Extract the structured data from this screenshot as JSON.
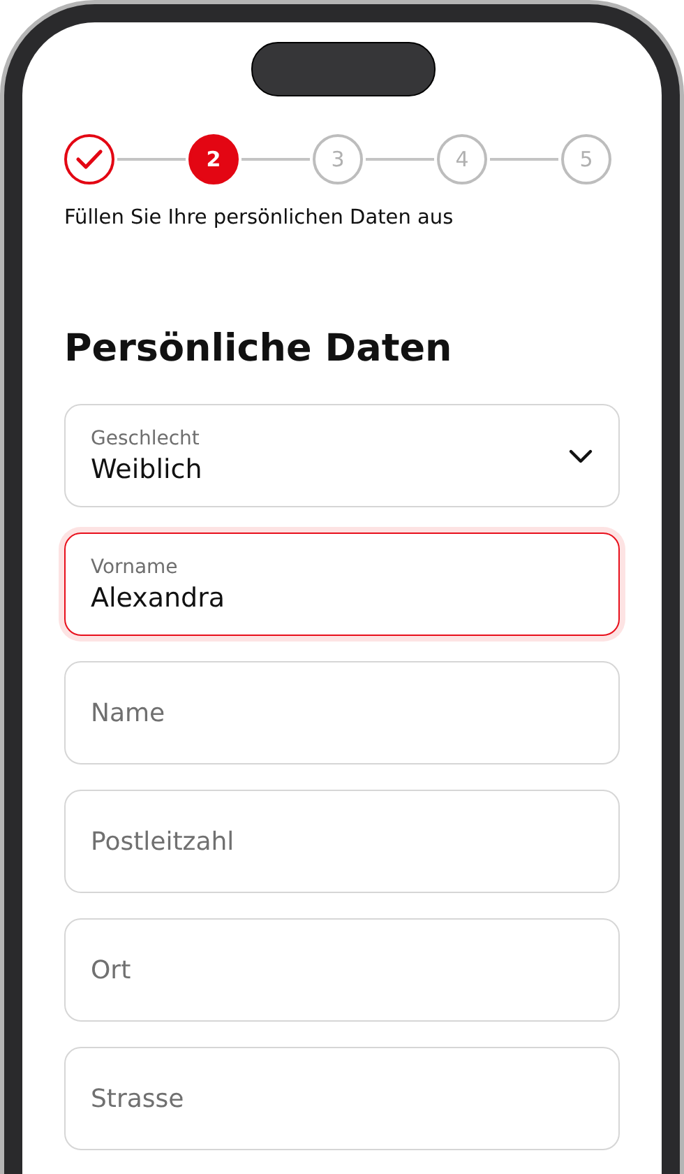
{
  "stepper": {
    "steps": [
      {
        "completed": true,
        "selected": false
      },
      {
        "label": "2",
        "completed": false,
        "selected": true
      },
      {
        "label": "3",
        "completed": false,
        "selected": false
      },
      {
        "label": "4",
        "completed": false,
        "selected": false
      },
      {
        "label": "5",
        "completed": false,
        "selected": false
      }
    ]
  },
  "subtitle": "Füllen Sie Ihre persönlichen Daten aus",
  "heading": "Persönliche Daten",
  "fields": [
    {
      "kind": "select",
      "label": "Geschlecht",
      "value": "Weiblich",
      "focused": false
    },
    {
      "kind": "text",
      "label": "Vorname",
      "value": "Alexandra",
      "focused": true
    },
    {
      "kind": "text",
      "placeholder": "Name",
      "focused": false
    },
    {
      "kind": "text",
      "placeholder": "Postleitzahl",
      "focused": false
    },
    {
      "kind": "text",
      "placeholder": "Ort",
      "focused": false
    },
    {
      "kind": "text",
      "placeholder": "Strasse",
      "focused": false
    }
  ]
}
